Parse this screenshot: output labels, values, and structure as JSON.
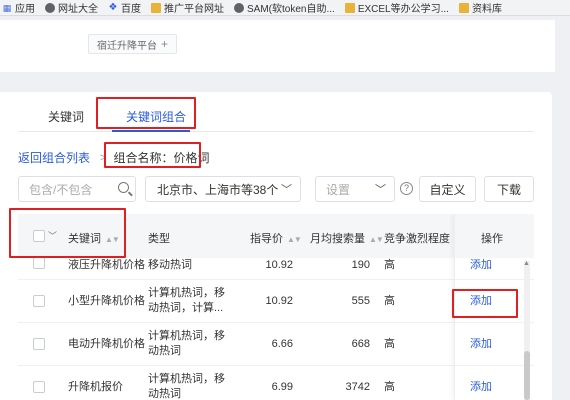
{
  "bookmarks": [
    {
      "label": "应用",
      "icon": "apps-grid-icon"
    },
    {
      "label": "网址大全",
      "icon": "globe-icon"
    },
    {
      "label": "百度",
      "icon": "baidu-paw-icon"
    },
    {
      "label": "推广平台网址",
      "icon": "folder-icon"
    },
    {
      "label": "SAM(软token自助...",
      "icon": "globe-icon"
    },
    {
      "label": "EXCEL等办公学习...",
      "icon": "folder-icon"
    },
    {
      "label": "资料库",
      "icon": "folder-icon"
    }
  ],
  "top_card": {
    "tag_label": "宿迁升降平台",
    "tag_plus": "+"
  },
  "tabs": [
    {
      "label": "关键词",
      "active": false
    },
    {
      "label": "关键词组合",
      "active": true
    }
  ],
  "breadcrumb": {
    "back_link": "返回组合列表",
    "separator": ">",
    "group_name": "组合名称：价格词"
  },
  "filters": {
    "search_placeholder": "包含/不包含",
    "city_value": "北京市、上海市等38个",
    "settings_placeholder": "设置",
    "help_icon": "?",
    "custom_label": "自定义",
    "download_label": "下载"
  },
  "table": {
    "headers": {
      "keyword": "关键词",
      "type": "类型",
      "price": "指导价",
      "volume": "月均搜索量",
      "competition": "竞争激烈程度",
      "operation": "操作"
    },
    "rows": [
      {
        "keyword": "液压升降机价格",
        "type": "移动热词",
        "price": "10.92",
        "volume": "190",
        "competition": "高",
        "op": "添加"
      },
      {
        "keyword": "小型升降机价格",
        "type": "计算机热词，移动热词，计算...",
        "price": "10.92",
        "volume": "555",
        "competition": "高",
        "op": "添加"
      },
      {
        "keyword": "电动升降机价格",
        "type": "计算机热词，移动热词",
        "price": "6.66",
        "volume": "668",
        "competition": "高",
        "op": "添加"
      },
      {
        "keyword": "升降机报价",
        "type": "计算机热词，移动热词",
        "price": "6.99",
        "volume": "3742",
        "competition": "高",
        "op": "添加"
      }
    ]
  },
  "colors": {
    "accent": "#2a5bd7",
    "annotation_red": "#e02020"
  }
}
